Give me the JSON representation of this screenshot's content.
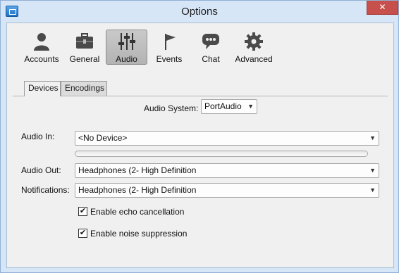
{
  "window": {
    "title": "Options",
    "close_label": "✕"
  },
  "toolbar": {
    "items": [
      {
        "label": "Accounts",
        "icon": "person-icon"
      },
      {
        "label": "General",
        "icon": "toolbox-icon"
      },
      {
        "label": "Audio",
        "icon": "mixer-sliders-icon",
        "active": true
      },
      {
        "label": "Events",
        "icon": "flag-icon"
      },
      {
        "label": "Chat",
        "icon": "speech-bubble-icon"
      },
      {
        "label": "Advanced",
        "icon": "gear-icon"
      }
    ]
  },
  "tabs": [
    {
      "label": "Devices",
      "active": true
    },
    {
      "label": "Encodings",
      "active": false
    }
  ],
  "devices": {
    "audio_system_label": "Audio System:",
    "audio_system_value": "PortAudio",
    "audio_in_label": "Audio In:",
    "audio_in_value": "<No Device>",
    "audio_out_label": "Audio Out:",
    "audio_out_value": "Headphones (2- High Definition",
    "notifications_label": "Notifications:",
    "notifications_value": "Headphones (2- High Definition",
    "input_level": 0,
    "echo_label": "Enable echo cancellation",
    "echo_checked": true,
    "noise_label": "Enable noise suppression",
    "noise_checked": true
  }
}
